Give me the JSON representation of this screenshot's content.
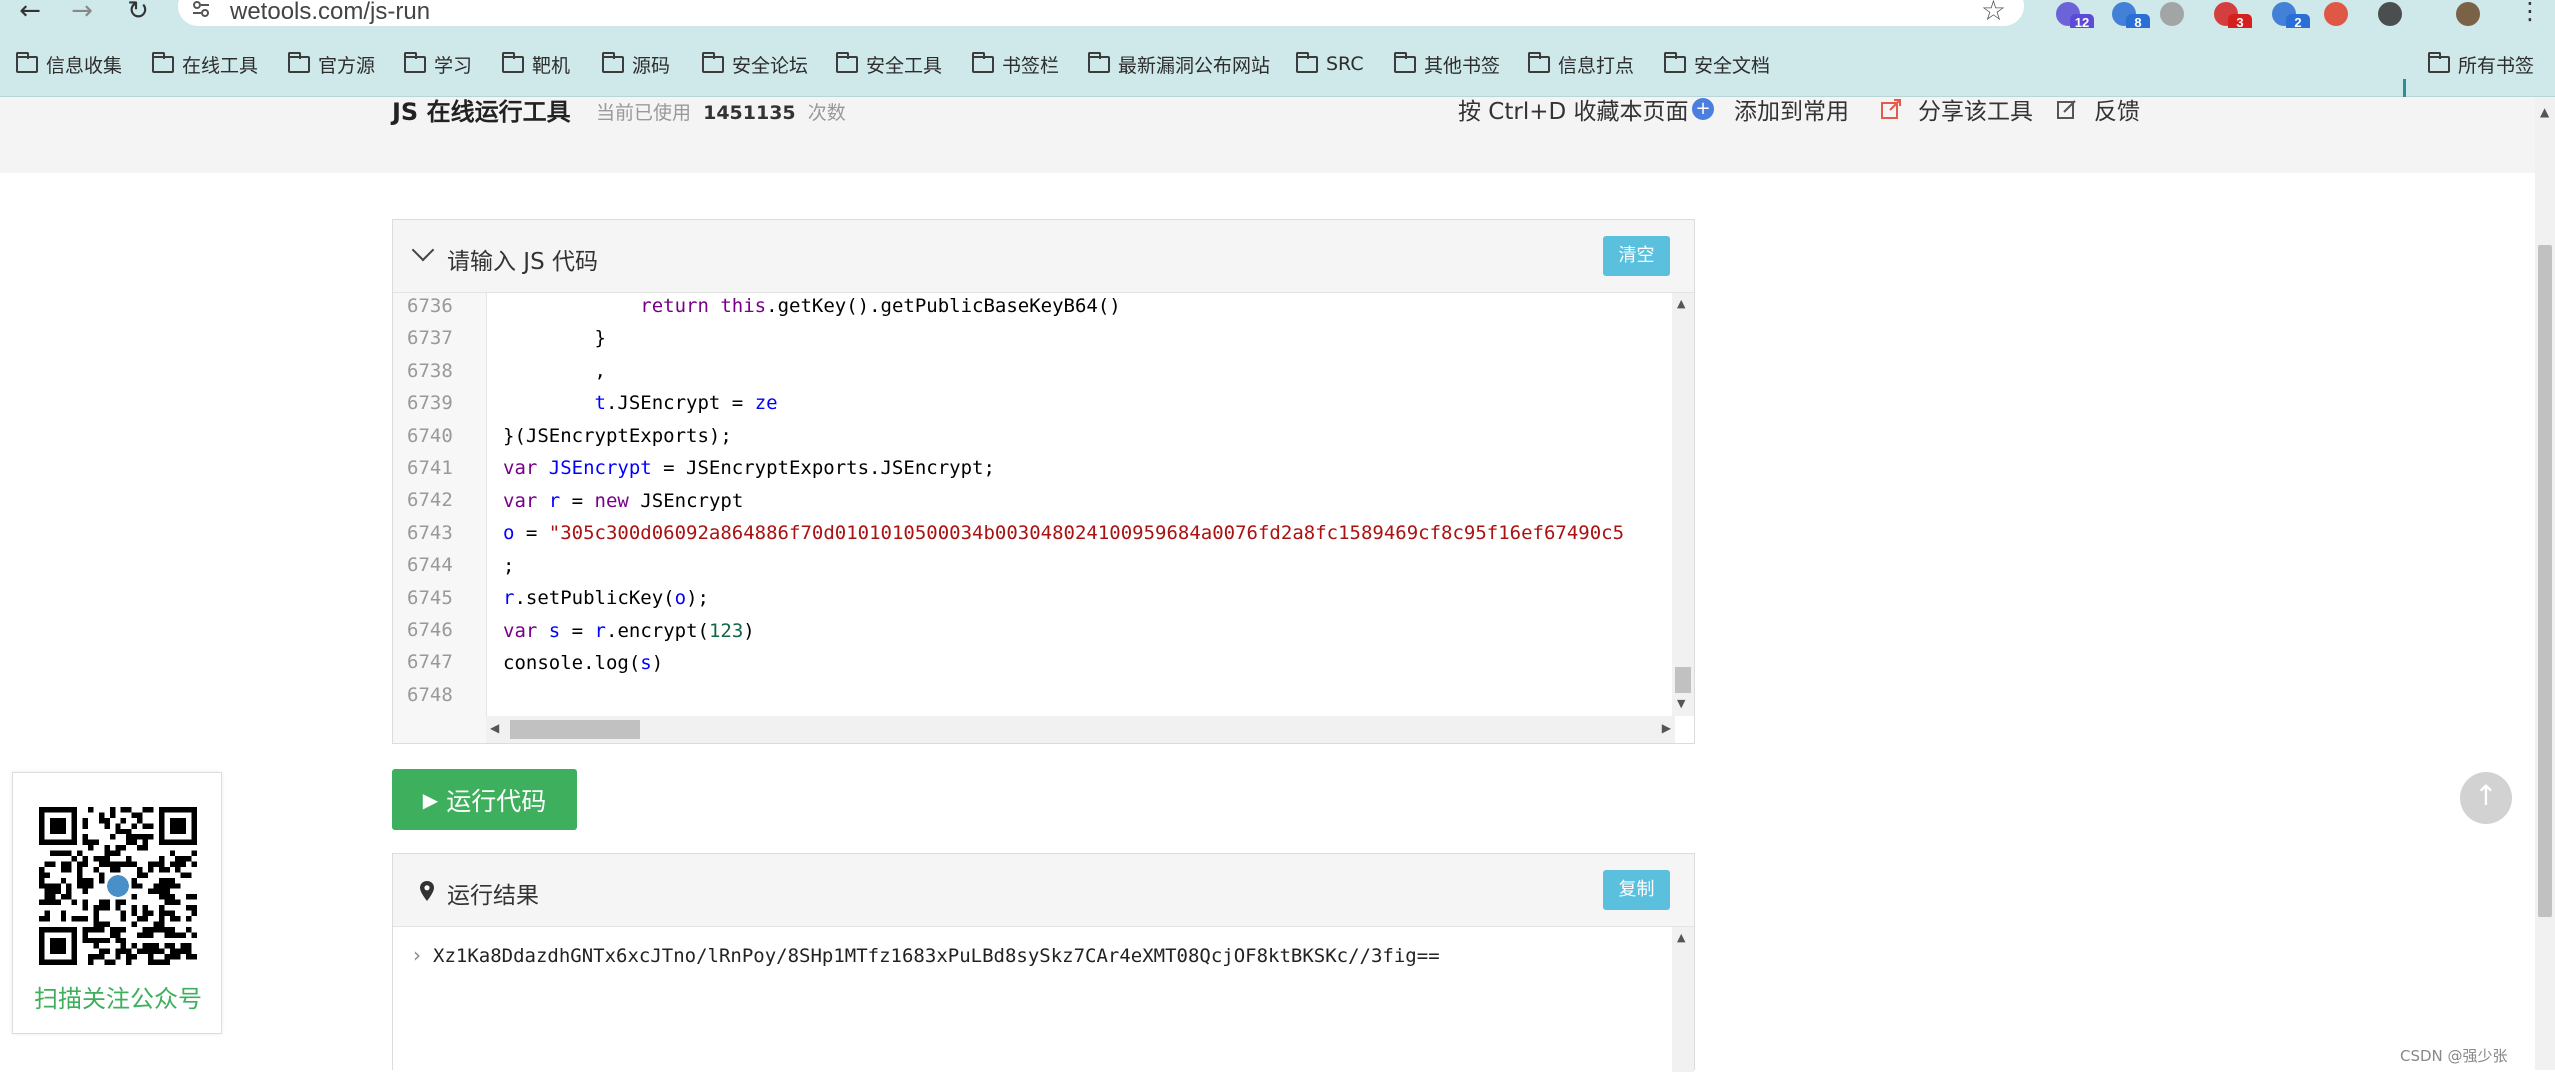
{
  "browser": {
    "url": "wetools.com/js-run",
    "extensions": [
      {
        "icon": "tabs-extension-icon",
        "badge": "12",
        "color": "#5b4bd6"
      },
      {
        "icon": "panda-extension-icon",
        "badge": "8",
        "color": "#2a6fd6"
      },
      {
        "icon": "circle-extension-icon",
        "badge": "",
        "color": "#999999"
      },
      {
        "icon": "globe-extension-icon",
        "badge": "3",
        "color": "#d62020"
      },
      {
        "icon": "cookie-extension-icon",
        "badge": "2",
        "color": "#2a6fd6"
      },
      {
        "icon": "fe-extension-icon",
        "badge": "",
        "color": "#e23d28"
      },
      {
        "icon": "puzzle-extension-icon",
        "badge": "",
        "color": "#333333"
      },
      {
        "icon": "profile-avatar-icon",
        "badge": "",
        "color": "#6b4a2a"
      }
    ]
  },
  "bookmarks": {
    "items": [
      "信息收集",
      "在线工具",
      "官方源",
      "学习",
      "靶机",
      "源码",
      "安全论坛",
      "安全工具",
      "书签栏",
      "最新漏洞公布网站",
      "SRC",
      "其他书签",
      "信息打点",
      "安全文档"
    ],
    "all_bookmarks": "所有书签"
  },
  "header": {
    "title": "JS 在线运行工具",
    "usage_prefix": "当前已使用",
    "usage_count": "1451135",
    "usage_suffix": "次数",
    "bookmark_hint": "按 Ctrl+D 收藏本页面",
    "add_common": "添加到常用",
    "share": "分享该工具",
    "feedback": "反馈"
  },
  "editor": {
    "title": "请输入 JS 代码",
    "clear_label": "清空",
    "lines": [
      {
        "num": "6736",
        "indent": 6
      },
      {
        "num": "6737",
        "indent": 4
      },
      {
        "num": "6738",
        "indent": 4
      },
      {
        "num": "6739",
        "indent": 4
      },
      {
        "num": "6740",
        "indent": 0
      },
      {
        "num": "6741",
        "indent": 0
      },
      {
        "num": "6742",
        "indent": 0
      },
      {
        "num": "6743",
        "indent": 0
      },
      {
        "num": "6744",
        "indent": 0
      },
      {
        "num": "6745",
        "indent": 0
      },
      {
        "num": "6746",
        "indent": 0
      },
      {
        "num": "6747",
        "indent": 0
      },
      {
        "num": "6748",
        "indent": 0
      }
    ],
    "code": {
      "l6736a": "return",
      "l6736b": " this",
      "l6736c": ".getKey().getPublicBaseKeyB64()",
      "l6737": "}",
      "l6738": ",",
      "l6739a": "t",
      "l6739b": ".JSEncrypt = ",
      "l6739c": "ze",
      "l6740": "}(JSEncryptExports);",
      "l6741a": "var",
      "l6741b": " JSEncrypt",
      "l6741c": " = JSEncryptExports.JSEncrypt;",
      "l6742a": "var",
      "l6742b": " r",
      "l6742c": " = ",
      "l6742d": "new",
      "l6742e": " JSEncrypt",
      "l6743a": "o",
      "l6743b": " = ",
      "l6743c": "\"305c300d06092a864886f70d0101010500034b003048024100959684a0076fd2a8fc1589469cf8c95f16ef67490c5",
      "l6744": ";",
      "l6745a": "r",
      "l6745b": ".setPublicKey(",
      "l6745c": "o",
      "l6745d": ");",
      "l6746a": "var",
      "l6746b": " s",
      "l6746c": " = ",
      "l6746d": "r",
      "l6746e": ".encrypt(",
      "l6746f": "123",
      "l6746g": ")",
      "l6747a": "console.log(",
      "l6747b": "s",
      "l6747c": ")"
    }
  },
  "run_button": "运行代码",
  "result": {
    "title": "运行结果",
    "copy_label": "复制",
    "output": "Xz1Ka8DdazdhGNTx6xcJTno/lRnPoy/8SHp1MTfz1683xPuLBd8sySkz7CAr4eXMT08QcjOF8ktBKSKc//3fig=="
  },
  "qr": {
    "caption": "扫描关注公众号"
  },
  "watermark": "CSDN @强少张",
  "colors": {
    "accent_green": "#3eaf5c",
    "info_blue": "#5bc0de",
    "chrome_bg": "#cfe8ea"
  }
}
